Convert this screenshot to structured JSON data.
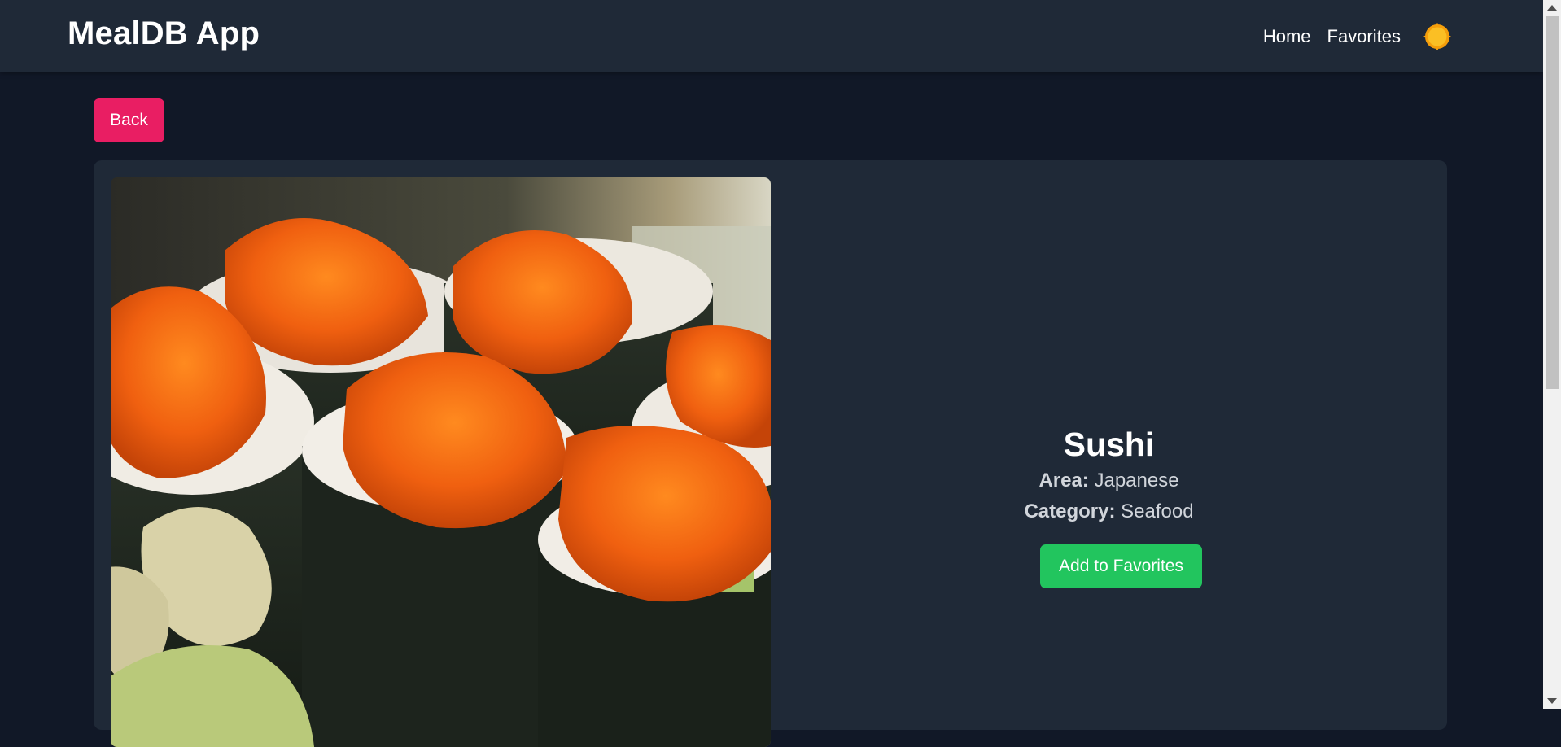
{
  "navbar": {
    "brand": "MealDB App",
    "links": [
      {
        "label": "Home"
      },
      {
        "label": "Favorites"
      }
    ],
    "theme_icon": "sun-icon"
  },
  "actions": {
    "back_label": "Back",
    "favorite_label": "Add to Favorites"
  },
  "meal": {
    "name": "Sushi",
    "area_label": "Area:",
    "area": "Japanese",
    "category_label": "Category:",
    "category": "Seafood",
    "image_icon": "meal-photo"
  },
  "colors": {
    "page_bg": "#111827",
    "surface": "#1f2937",
    "back_button": "#e91e63",
    "favorite_button": "#22c55e",
    "sun": "#fbbf24"
  }
}
